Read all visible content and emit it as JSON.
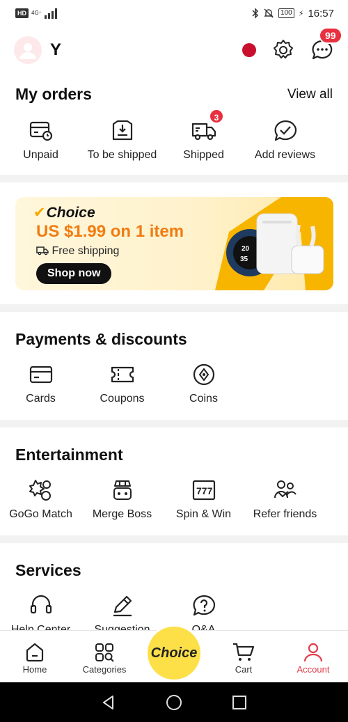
{
  "status_bar": {
    "network": "4G⁺",
    "time": "16:57",
    "battery": "100"
  },
  "header": {
    "username": "Y",
    "messages_badge": "99"
  },
  "orders": {
    "title": "My orders",
    "view_all": "View all",
    "items": [
      {
        "label": "Unpaid",
        "icon": "wallet-clock-icon"
      },
      {
        "label": "To be shipped",
        "icon": "package-down-icon"
      },
      {
        "label": "Shipped",
        "icon": "truck-icon",
        "badge": "3"
      },
      {
        "label": "Add reviews",
        "icon": "review-chat-icon"
      }
    ]
  },
  "banner": {
    "brand": "Choice",
    "promo": "US $1.99 on 1 item",
    "free_shipping": "Free shipping",
    "cta": "Shop now"
  },
  "payments": {
    "title": "Payments & discounts",
    "items": [
      {
        "label": "Cards",
        "icon": "card-icon"
      },
      {
        "label": "Coupons",
        "icon": "coupon-icon"
      },
      {
        "label": "Coins",
        "icon": "coin-icon"
      }
    ]
  },
  "entertainment": {
    "title": "Entertainment",
    "items": [
      {
        "label": "GoGo Match",
        "icon": "gogo-match-icon"
      },
      {
        "label": "Merge Boss",
        "icon": "merge-boss-icon"
      },
      {
        "label": "Spin & Win",
        "icon": "slot-777-icon"
      },
      {
        "label": "Refer friends",
        "icon": "refer-friends-icon"
      }
    ]
  },
  "services": {
    "title": "Services",
    "items": [
      {
        "label": "Help Center",
        "icon": "headset-icon"
      },
      {
        "label": "Suggestion",
        "icon": "pencil-icon"
      },
      {
        "label": "Q&A",
        "icon": "question-icon"
      }
    ]
  },
  "bottom_nav": {
    "items": [
      {
        "label": "Home",
        "icon": "home-icon"
      },
      {
        "label": "Categories",
        "icon": "categories-icon"
      },
      {
        "label": "Choice",
        "icon": "choice-icon"
      },
      {
        "label": "Cart",
        "icon": "cart-icon"
      },
      {
        "label": "Account",
        "icon": "account-icon",
        "active": true
      }
    ]
  },
  "colors": {
    "accent": "#e23b48",
    "badge": "#e8303f",
    "choice_yellow": "#fde047",
    "promo_orange": "#f07c12"
  }
}
